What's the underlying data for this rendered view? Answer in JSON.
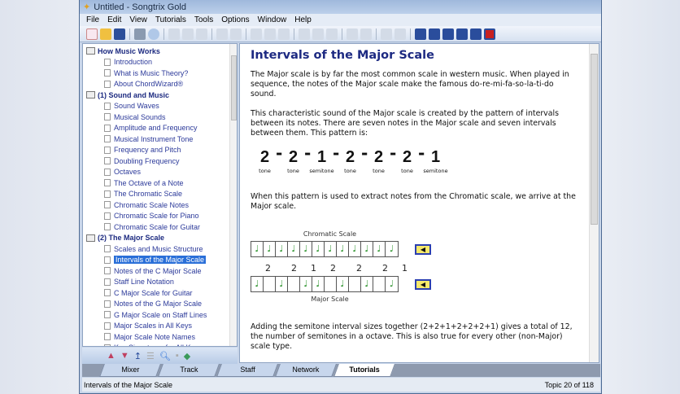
{
  "window": {
    "title": "Untitled - Songtrix Gold"
  },
  "menu": [
    "File",
    "Edit",
    "View",
    "Tutorials",
    "Tools",
    "Options",
    "Window",
    "Help"
  ],
  "tree": [
    {
      "label": "How Music Works",
      "type": "heading"
    },
    {
      "label": "Introduction"
    },
    {
      "label": "What is Music Theory?"
    },
    {
      "label": "About ChordWizard®"
    },
    {
      "label": "(1)  Sound and Music",
      "type": "heading"
    },
    {
      "label": "Sound Waves"
    },
    {
      "label": "Musical Sounds"
    },
    {
      "label": "Amplitude and Frequency"
    },
    {
      "label": "Musical Instrument Tone"
    },
    {
      "label": "Frequency and Pitch"
    },
    {
      "label": "Doubling Frequency"
    },
    {
      "label": "Octaves"
    },
    {
      "label": "The Octave of a Note"
    },
    {
      "label": "The Chromatic Scale"
    },
    {
      "label": "Chromatic Scale Notes"
    },
    {
      "label": "Chromatic Scale for Piano"
    },
    {
      "label": "Chromatic Scale for Guitar"
    },
    {
      "label": "(2)  The Major Scale",
      "type": "heading"
    },
    {
      "label": "Scales and Music Structure"
    },
    {
      "label": "Intervals of the Major Scale",
      "selected": true
    },
    {
      "label": "Notes of the C Major Scale"
    },
    {
      "label": "Staff Line Notation"
    },
    {
      "label": "C Major Scale for Guitar"
    },
    {
      "label": "Notes of the G Major Scale"
    },
    {
      "label": "G Major Scale on Staff Lines"
    },
    {
      "label": "Major Scales in All Keys"
    },
    {
      "label": "Major Scale Note Names"
    },
    {
      "label": "Key Signatures for All Keys"
    }
  ],
  "content": {
    "title": "Intervals of the Major Scale",
    "p1": "The Major scale is by far the most common scale in western music.  When played in sequence, the notes of the Major scale make the famous do-re-mi-fa-so-la-ti-do sound.",
    "p2": "This characteristic sound of the Major scale is created by the pattern of intervals between its notes.  There are seven notes in the Major scale and seven intervals between them.  This pattern is:",
    "pattern": [
      {
        "n": "2",
        "l": "tone"
      },
      {
        "n": "2",
        "l": "tone"
      },
      {
        "n": "1",
        "l": "semitone"
      },
      {
        "n": "2",
        "l": "tone"
      },
      {
        "n": "2",
        "l": "tone"
      },
      {
        "n": "2",
        "l": "tone"
      },
      {
        "n": "1",
        "l": "semitone"
      }
    ],
    "p3": "When this pattern is used to extract notes from the Chromatic scale, we arrive at the Major scale.",
    "chromatic_label": "Chromatic Scale",
    "major_label": "Major Scale",
    "major_notes": [
      1,
      0,
      1,
      0,
      1,
      1,
      0,
      1,
      0,
      1,
      0,
      1
    ],
    "arc_numbers": [
      "2",
      "2",
      "1",
      "2",
      "2",
      "2",
      "1"
    ],
    "p4": "Adding the semitone interval sizes together (2+2+1+2+2+2+1) gives a total of 12, the number of semitones in a octave.  This is also true for every other (non-Major) scale type."
  },
  "tabs": [
    {
      "label": "Mixer"
    },
    {
      "label": "Track"
    },
    {
      "label": "Staff"
    },
    {
      "label": "Network"
    },
    {
      "label": "Tutorials",
      "active": true
    }
  ],
  "status": {
    "left": "Intervals of the Major Scale",
    "right": "Topic 20 of 118"
  }
}
